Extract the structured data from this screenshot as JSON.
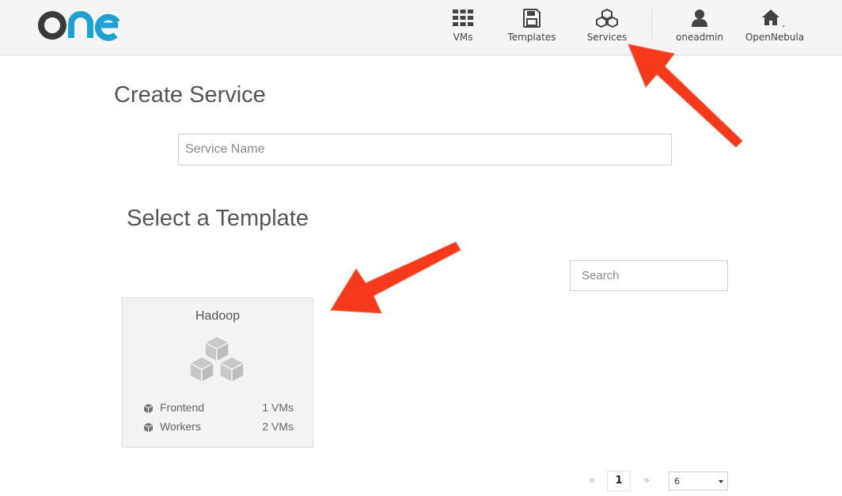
{
  "header": {
    "logo_text": "one",
    "nav": [
      {
        "label": "VMs",
        "icon": "grid-icon"
      },
      {
        "label": "Templates",
        "icon": "floppy-disk-icon"
      },
      {
        "label": "Services",
        "icon": "cubes-icon"
      },
      {
        "label": "oneadmin",
        "icon": "user-icon"
      },
      {
        "label": "OpenNebula",
        "icon": "home-icon"
      }
    ]
  },
  "create": {
    "title": "Create Service",
    "service_name_placeholder": "Service Name"
  },
  "templates": {
    "title": "Select a Template",
    "search_placeholder": "Search",
    "cards": [
      {
        "name": "Hadoop",
        "icon": "cubes-icon",
        "roles": [
          {
            "name": "Frontend",
            "vms": "1 VMs"
          },
          {
            "name": "Workers",
            "vms": "2 VMs"
          }
        ]
      }
    ]
  },
  "pagination": {
    "prev": "«",
    "current": "1",
    "next": "»",
    "page_size": "6"
  },
  "colors": {
    "logo_dark": "#3a3a3a",
    "logo_accent": "#1ba1d4",
    "annotation_arrow": "#f53a1c"
  }
}
